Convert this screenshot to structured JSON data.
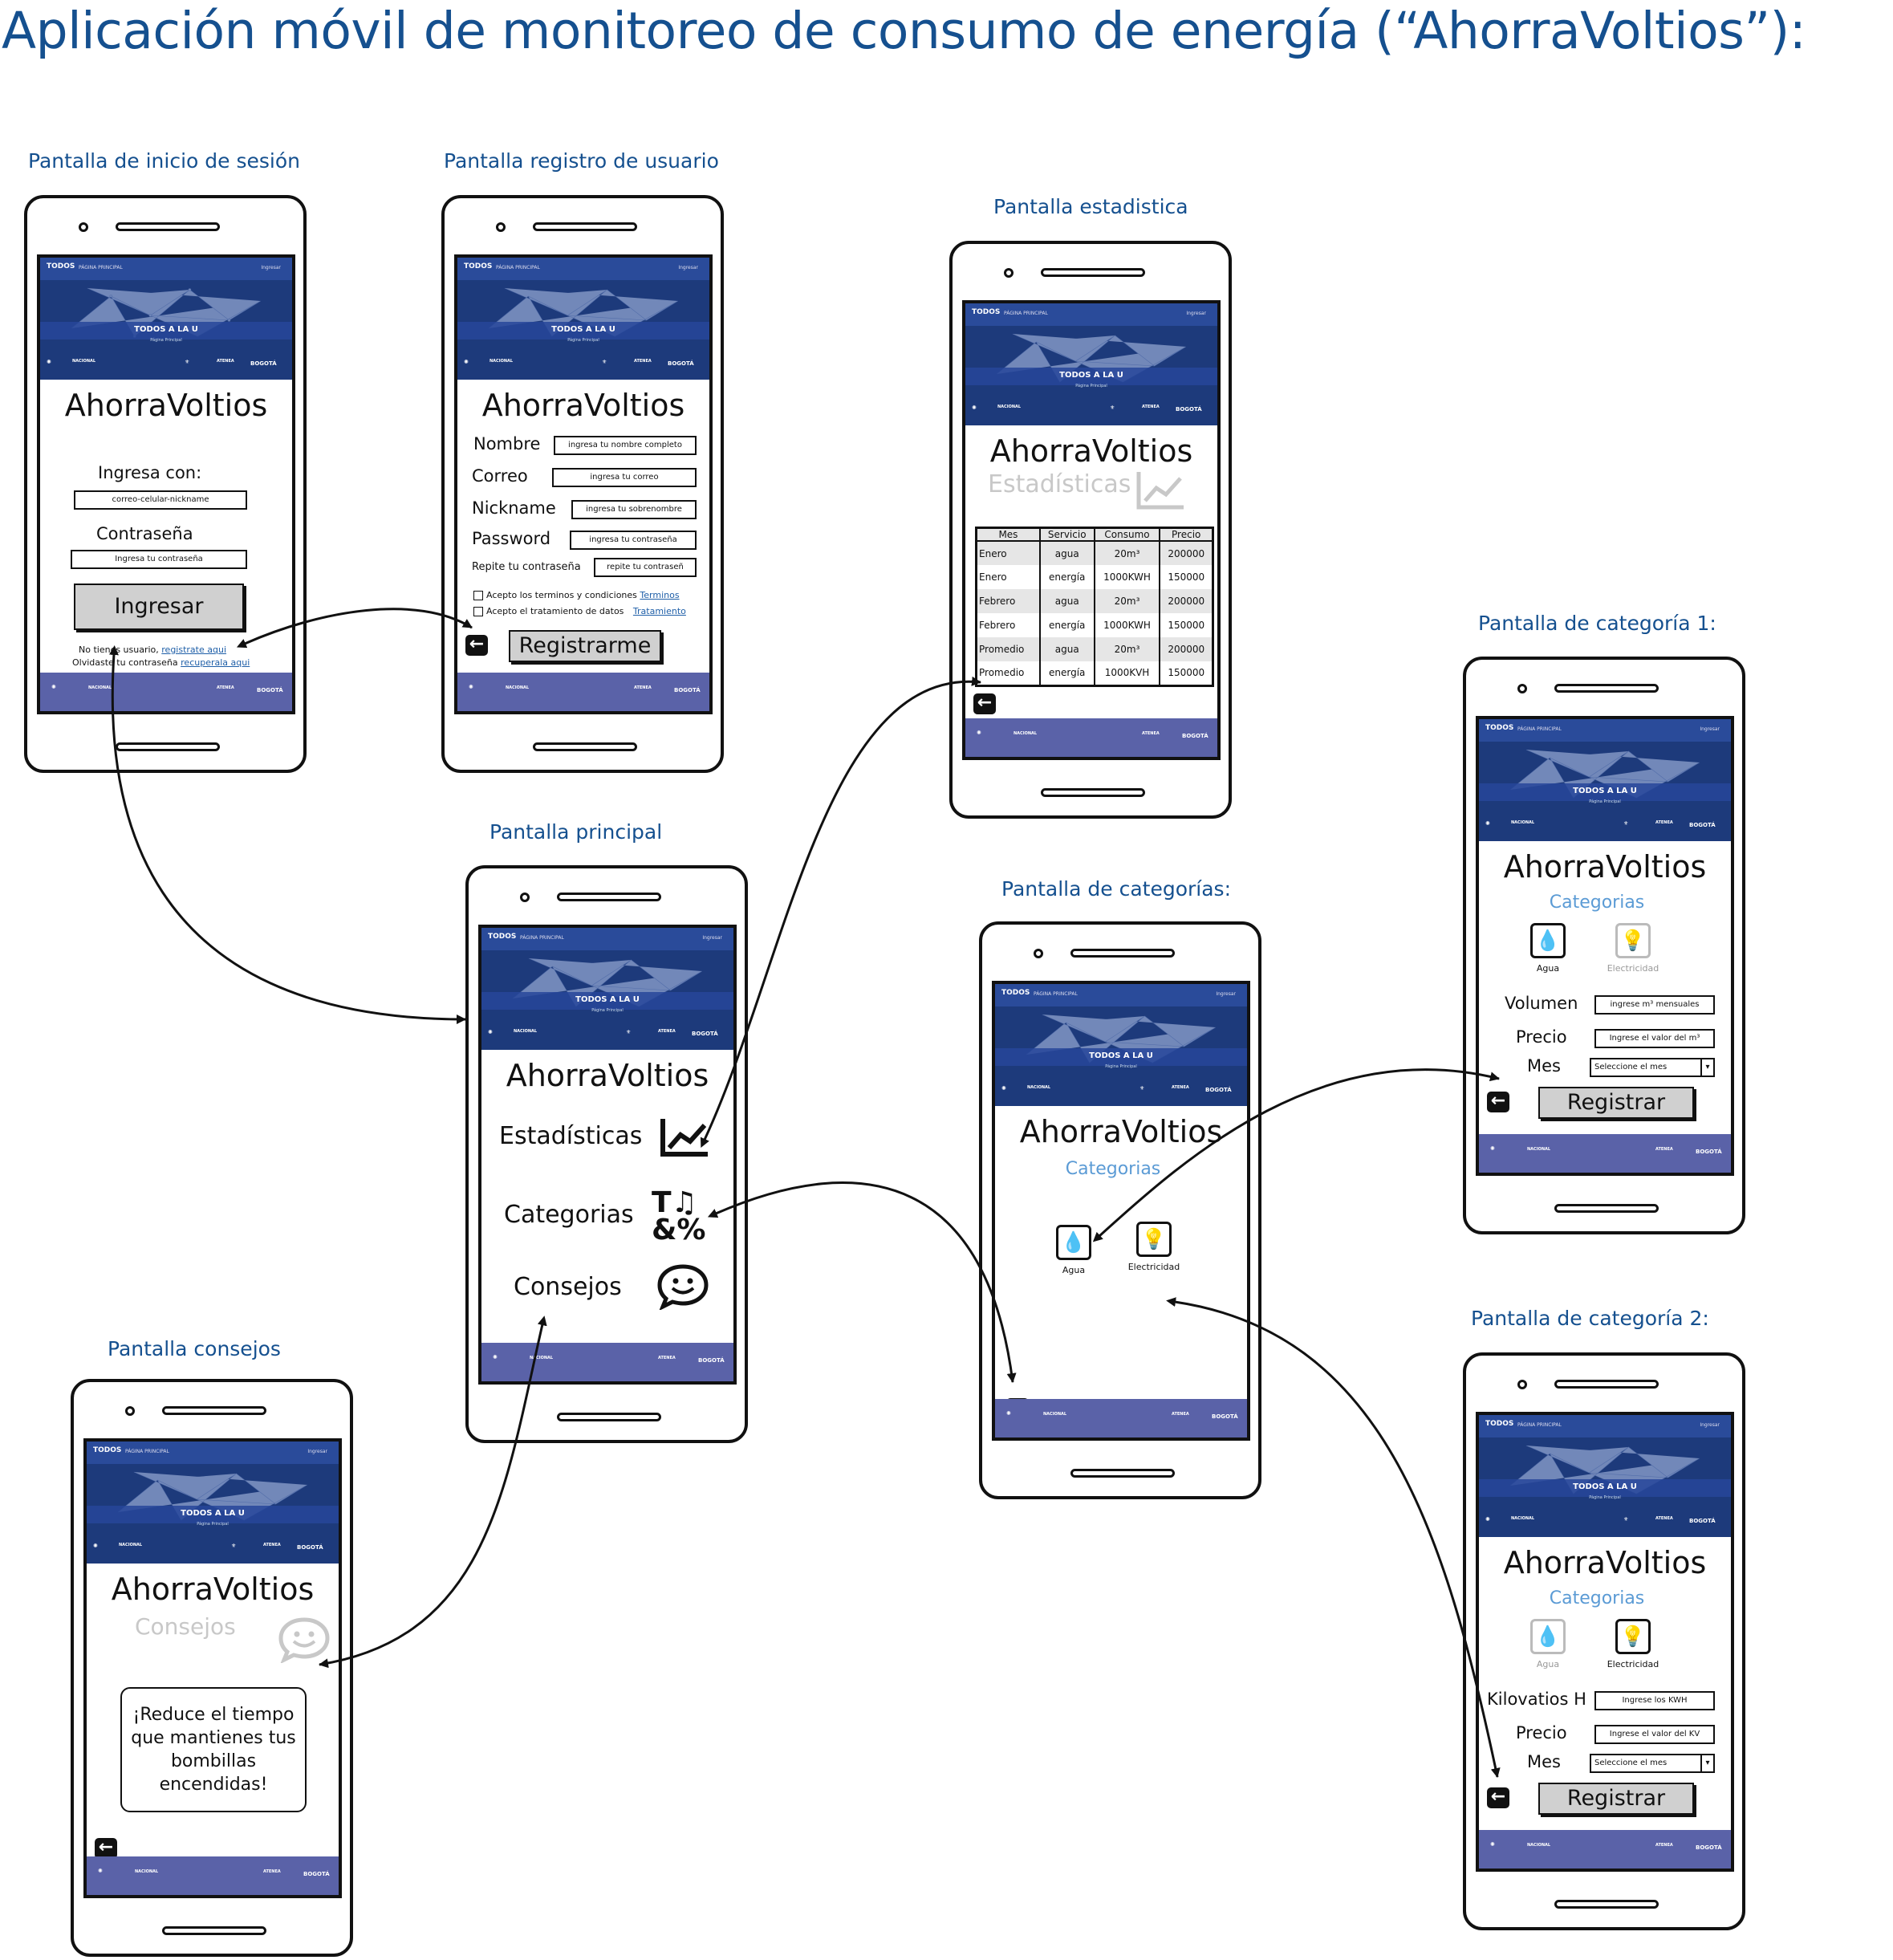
{
  "page_title": "Aplicación móvil de monitoreo de consumo de energía (“AhorraVoltios”):",
  "common": {
    "app_name": "AhorraVoltios",
    "banner_brand": "TODOS",
    "banner_nav": "PÁGINA PRINCIPAL",
    "banner_login": "Ingresar",
    "banner_heading": "TODOS A LA U",
    "banner_sub": "Página Principal",
    "logo_bogota": "BOGOTÁ",
    "logo_unal": "NACIONAL",
    "logo_atenea": "ATENEA",
    "back_icon": "arrow-left-icon"
  },
  "login": {
    "screen_title": "Pantalla de inicio de sesión",
    "ingresa_con": "Ingresa con:",
    "user_placeholder": "correo-celular-nickname",
    "password_label": "Contraseña",
    "password_placeholder": "Ingresa tu contraseña",
    "button": "Ingresar",
    "no_account_prefix": "No tienes usuario,",
    "no_account_link": "registrate aqui",
    "forgot_prefix": "Olvidaste tu contraseña",
    "forgot_link": "recuperala aqui"
  },
  "register": {
    "screen_title": "Pantalla registro de usuario",
    "fields": [
      {
        "label": "Nombre",
        "placeholder": "ingresa tu nombre completo"
      },
      {
        "label": "Correo",
        "placeholder": "ingresa tu correo"
      },
      {
        "label": "Nickname",
        "placeholder": "ingresa tu sobrenombre"
      },
      {
        "label": "Password",
        "placeholder": "ingresa tu contraseña"
      },
      {
        "label": "Repite tu contraseña",
        "placeholder": "repite tu contraseñ"
      }
    ],
    "terms_text": "Acepto los terminos y condiciones",
    "terms_link": "Terminos",
    "data_text": "Acepto el tratamiento de datos",
    "data_link": "Tratamiento",
    "button": "Registrarme"
  },
  "stats": {
    "screen_title": "Pantalla estadistica",
    "section": "Estadísticas",
    "columns": [
      "Mes",
      "Servicio",
      "Consumo",
      "Precio"
    ],
    "rows": [
      [
        "Enero",
        "agua",
        "20m³",
        "200000"
      ],
      [
        "Enero",
        "energía",
        "1000KWH",
        "150000"
      ],
      [
        "Febrero",
        "agua",
        "20m³",
        "200000"
      ],
      [
        "Febrero",
        "energía",
        "1000KWH",
        "150000"
      ],
      [
        "Promedio",
        "agua",
        "20m³",
        "200000"
      ],
      [
        "Promedio",
        "energía",
        "1000KVH",
        "150000"
      ]
    ]
  },
  "main": {
    "screen_title": "Pantalla principal",
    "items": [
      {
        "label": "Estadísticas",
        "icon": "chart-line-icon"
      },
      {
        "label": "Categorias",
        "icon": "categories-icon"
      },
      {
        "label": "Consejos",
        "icon": "smiley-chat-icon"
      }
    ]
  },
  "categories": {
    "screen_title": "Pantalla de categorías:",
    "section": "Categorias",
    "water": "Agua",
    "electricity": "Electricidad"
  },
  "cat1": {
    "screen_title": "Pantalla de categoría 1:",
    "section": "Categorias",
    "water": "Agua",
    "electricity": "Electricidad",
    "volume_label": "Volumen",
    "volume_placeholder": "ingrese m³ mensuales",
    "price_label": "Precio",
    "price_placeholder": "Ingrese el valor del m³",
    "month_label": "Mes",
    "month_select": "Seleccione el mes",
    "button": "Registrar"
  },
  "cat2": {
    "screen_title": "Pantalla de categoría 2:",
    "section": "Categorias",
    "water": "Agua",
    "electricity": "Electricidad",
    "kwh_label": "Kilovatios H",
    "kwh_placeholder": "Ingrese los KWH",
    "price_label": "Precio",
    "price_placeholder": "Ingrese el valor del KV",
    "month_label": "Mes",
    "month_select": "Seleccione el mes",
    "button": "Registrar"
  },
  "tips": {
    "screen_title": "Pantalla consejos",
    "section": "Consejos",
    "tip": "¡Reduce el tiempo que mantienes tus bombillas encendidas!"
  },
  "colors": {
    "title_blue": "#15508f",
    "banner": "#1d3a7b",
    "footer": "#5a62a8",
    "section_blue": "#5b9bd5"
  }
}
